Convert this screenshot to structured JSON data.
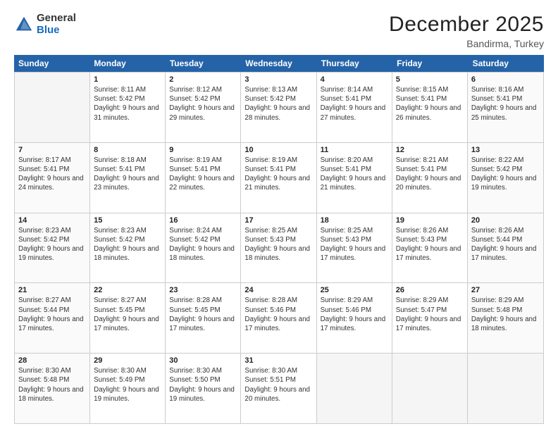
{
  "logo": {
    "general": "General",
    "blue": "Blue"
  },
  "header": {
    "month": "December 2025",
    "location": "Bandirma, Turkey"
  },
  "weekdays": [
    "Sunday",
    "Monday",
    "Tuesday",
    "Wednesday",
    "Thursday",
    "Friday",
    "Saturday"
  ],
  "weeks": [
    [
      {
        "day": "",
        "sunrise": "",
        "sunset": "",
        "daylight": "",
        "empty": true
      },
      {
        "day": "1",
        "sunrise": "Sunrise: 8:11 AM",
        "sunset": "Sunset: 5:42 PM",
        "daylight": "Daylight: 9 hours and 31 minutes."
      },
      {
        "day": "2",
        "sunrise": "Sunrise: 8:12 AM",
        "sunset": "Sunset: 5:42 PM",
        "daylight": "Daylight: 9 hours and 29 minutes."
      },
      {
        "day": "3",
        "sunrise": "Sunrise: 8:13 AM",
        "sunset": "Sunset: 5:42 PM",
        "daylight": "Daylight: 9 hours and 28 minutes."
      },
      {
        "day": "4",
        "sunrise": "Sunrise: 8:14 AM",
        "sunset": "Sunset: 5:41 PM",
        "daylight": "Daylight: 9 hours and 27 minutes."
      },
      {
        "day": "5",
        "sunrise": "Sunrise: 8:15 AM",
        "sunset": "Sunset: 5:41 PM",
        "daylight": "Daylight: 9 hours and 26 minutes."
      },
      {
        "day": "6",
        "sunrise": "Sunrise: 8:16 AM",
        "sunset": "Sunset: 5:41 PM",
        "daylight": "Daylight: 9 hours and 25 minutes."
      }
    ],
    [
      {
        "day": "7",
        "sunrise": "Sunrise: 8:17 AM",
        "sunset": "Sunset: 5:41 PM",
        "daylight": "Daylight: 9 hours and 24 minutes."
      },
      {
        "day": "8",
        "sunrise": "Sunrise: 8:18 AM",
        "sunset": "Sunset: 5:41 PM",
        "daylight": "Daylight: 9 hours and 23 minutes."
      },
      {
        "day": "9",
        "sunrise": "Sunrise: 8:19 AM",
        "sunset": "Sunset: 5:41 PM",
        "daylight": "Daylight: 9 hours and 22 minutes."
      },
      {
        "day": "10",
        "sunrise": "Sunrise: 8:19 AM",
        "sunset": "Sunset: 5:41 PM",
        "daylight": "Daylight: 9 hours and 21 minutes."
      },
      {
        "day": "11",
        "sunrise": "Sunrise: 8:20 AM",
        "sunset": "Sunset: 5:41 PM",
        "daylight": "Daylight: 9 hours and 21 minutes."
      },
      {
        "day": "12",
        "sunrise": "Sunrise: 8:21 AM",
        "sunset": "Sunset: 5:41 PM",
        "daylight": "Daylight: 9 hours and 20 minutes."
      },
      {
        "day": "13",
        "sunrise": "Sunrise: 8:22 AM",
        "sunset": "Sunset: 5:42 PM",
        "daylight": "Daylight: 9 hours and 19 minutes."
      }
    ],
    [
      {
        "day": "14",
        "sunrise": "Sunrise: 8:23 AM",
        "sunset": "Sunset: 5:42 PM",
        "daylight": "Daylight: 9 hours and 19 minutes."
      },
      {
        "day": "15",
        "sunrise": "Sunrise: 8:23 AM",
        "sunset": "Sunset: 5:42 PM",
        "daylight": "Daylight: 9 hours and 18 minutes."
      },
      {
        "day": "16",
        "sunrise": "Sunrise: 8:24 AM",
        "sunset": "Sunset: 5:42 PM",
        "daylight": "Daylight: 9 hours and 18 minutes."
      },
      {
        "day": "17",
        "sunrise": "Sunrise: 8:25 AM",
        "sunset": "Sunset: 5:43 PM",
        "daylight": "Daylight: 9 hours and 18 minutes."
      },
      {
        "day": "18",
        "sunrise": "Sunrise: 8:25 AM",
        "sunset": "Sunset: 5:43 PM",
        "daylight": "Daylight: 9 hours and 17 minutes."
      },
      {
        "day": "19",
        "sunrise": "Sunrise: 8:26 AM",
        "sunset": "Sunset: 5:43 PM",
        "daylight": "Daylight: 9 hours and 17 minutes."
      },
      {
        "day": "20",
        "sunrise": "Sunrise: 8:26 AM",
        "sunset": "Sunset: 5:44 PM",
        "daylight": "Daylight: 9 hours and 17 minutes."
      }
    ],
    [
      {
        "day": "21",
        "sunrise": "Sunrise: 8:27 AM",
        "sunset": "Sunset: 5:44 PM",
        "daylight": "Daylight: 9 hours and 17 minutes."
      },
      {
        "day": "22",
        "sunrise": "Sunrise: 8:27 AM",
        "sunset": "Sunset: 5:45 PM",
        "daylight": "Daylight: 9 hours and 17 minutes."
      },
      {
        "day": "23",
        "sunrise": "Sunrise: 8:28 AM",
        "sunset": "Sunset: 5:45 PM",
        "daylight": "Daylight: 9 hours and 17 minutes."
      },
      {
        "day": "24",
        "sunrise": "Sunrise: 8:28 AM",
        "sunset": "Sunset: 5:46 PM",
        "daylight": "Daylight: 9 hours and 17 minutes."
      },
      {
        "day": "25",
        "sunrise": "Sunrise: 8:29 AM",
        "sunset": "Sunset: 5:46 PM",
        "daylight": "Daylight: 9 hours and 17 minutes."
      },
      {
        "day": "26",
        "sunrise": "Sunrise: 8:29 AM",
        "sunset": "Sunset: 5:47 PM",
        "daylight": "Daylight: 9 hours and 17 minutes."
      },
      {
        "day": "27",
        "sunrise": "Sunrise: 8:29 AM",
        "sunset": "Sunset: 5:48 PM",
        "daylight": "Daylight: 9 hours and 18 minutes."
      }
    ],
    [
      {
        "day": "28",
        "sunrise": "Sunrise: 8:30 AM",
        "sunset": "Sunset: 5:48 PM",
        "daylight": "Daylight: 9 hours and 18 minutes."
      },
      {
        "day": "29",
        "sunrise": "Sunrise: 8:30 AM",
        "sunset": "Sunset: 5:49 PM",
        "daylight": "Daylight: 9 hours and 19 minutes."
      },
      {
        "day": "30",
        "sunrise": "Sunrise: 8:30 AM",
        "sunset": "Sunset: 5:50 PM",
        "daylight": "Daylight: 9 hours and 19 minutes."
      },
      {
        "day": "31",
        "sunrise": "Sunrise: 8:30 AM",
        "sunset": "Sunset: 5:51 PM",
        "daylight": "Daylight: 9 hours and 20 minutes."
      },
      {
        "day": "",
        "sunrise": "",
        "sunset": "",
        "daylight": "",
        "empty": true
      },
      {
        "day": "",
        "sunrise": "",
        "sunset": "",
        "daylight": "",
        "empty": true
      },
      {
        "day": "",
        "sunrise": "",
        "sunset": "",
        "daylight": "",
        "empty": true
      }
    ]
  ]
}
